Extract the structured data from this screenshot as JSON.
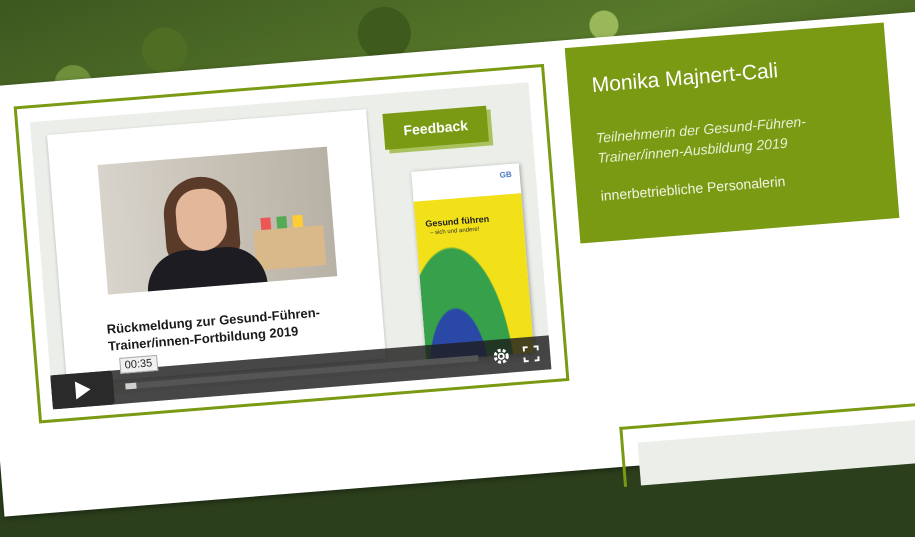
{
  "profile": {
    "name": "Monika Majnert-Cali",
    "role": "Teilnehmerin der Gesund-Führen-Trainer/innen-Ausbildung 2019",
    "job": "innerbetriebliche Personalerin"
  },
  "video": {
    "slide_caption": "Rückmeldung zur Gesund-Führen-Trainer/innen-Fortbildung 2019",
    "feedback_label": "Feedback",
    "book_title": "Gesund führen",
    "book_subtitle": "– sich und andere!",
    "current_time": "00:35",
    "progress": 0.03,
    "icons": [
      "play-icon",
      "gear-icon",
      "fullscreen-icon"
    ]
  },
  "colors": {
    "accent": "#7a9a14",
    "card": "#ffffff"
  }
}
